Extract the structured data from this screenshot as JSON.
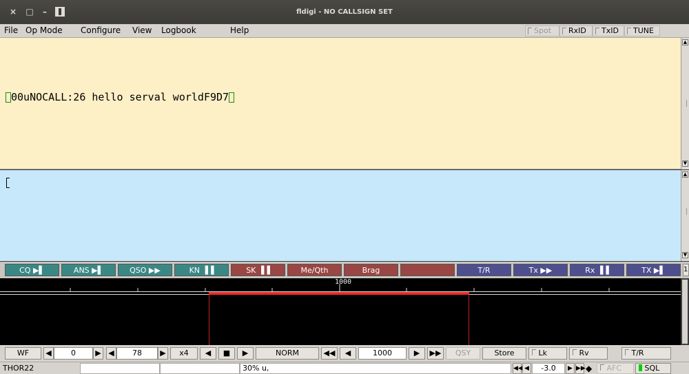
{
  "titlebar": {
    "title": "fldigi - NO CALLSIGN SET",
    "close": "×",
    "maximize": "□",
    "minimize": "–"
  },
  "menu": {
    "items": [
      "File",
      "Op Mode",
      "Configure",
      "View",
      "Logbook",
      "Help"
    ],
    "spot": "Spot",
    "rxid": "RxID",
    "txid": "TxID",
    "tune": "TUNE"
  },
  "rx": {
    "text_main": "00uNOCALL:26 hello serval worldF9D7"
  },
  "macros": [
    {
      "label": "CQ ▶▌",
      "color": "#3a8886"
    },
    {
      "label": "ANS ▶▌",
      "color": "#3a8886"
    },
    {
      "label": "QSO ▶▶",
      "color": "#3a8886"
    },
    {
      "label": "KN ▐▐",
      "color": "#3a8886"
    },
    {
      "label": "SK ▐▐",
      "color": "#9a4644"
    },
    {
      "label": "Me/Qth",
      "color": "#9a4644"
    },
    {
      "label": "Brag",
      "color": "#9a4644"
    },
    {
      "label": "",
      "color": "#9a4644"
    },
    {
      "label": "T/R",
      "color": "#4d4f8f"
    },
    {
      "label": "Tx ▶▶",
      "color": "#4d4f8f"
    },
    {
      "label": "Rx ▐▐",
      "color": "#4d4f8f"
    },
    {
      "label": "TX ▶▌",
      "color": "#4d4f8f"
    }
  ],
  "macro_set": "1",
  "waterfall": {
    "scale_label": "1000",
    "marker_color": "#e52b2b"
  },
  "controls": {
    "wf": "WF",
    "wf_value": "0",
    "wf_range": "78",
    "zoom": "x4",
    "mode": "NORM",
    "freq": "1000",
    "qsy": "QSY",
    "store": "Store",
    "lk": "Lk",
    "rv": "Rv",
    "tr": "T/R"
  },
  "status": {
    "mode": "THOR22",
    "field2": "",
    "field3": "",
    "message": "30% u,",
    "s2n": "-3.0",
    "afc": "AFC",
    "sql": "SQL"
  }
}
